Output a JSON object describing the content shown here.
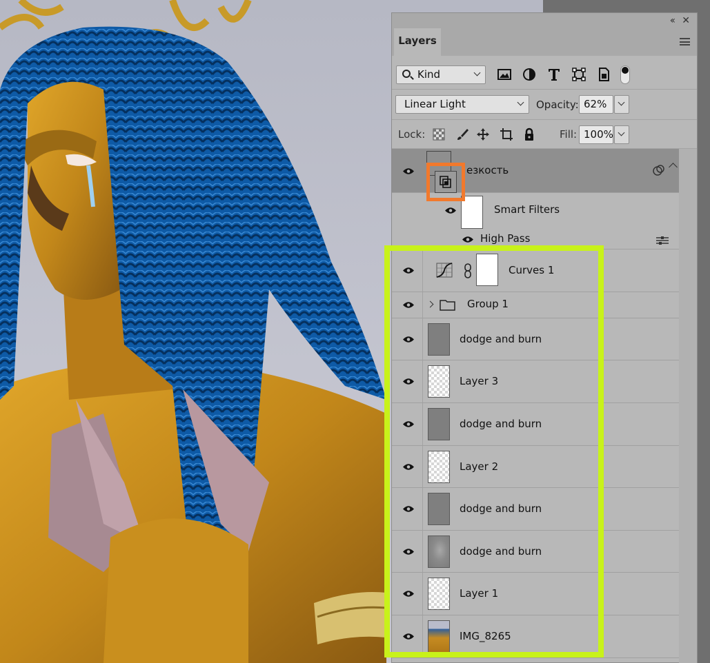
{
  "panel": {
    "tab_label": "Layers",
    "collapse_icon": "collapse-panel-icon",
    "close_icon": "close-icon",
    "menu_icon": "panel-menu-icon"
  },
  "filter": {
    "kind_label": "Kind",
    "icons": [
      "image-filter-icon",
      "adjustment-filter-icon",
      "type-filter-icon",
      "shape-filter-icon",
      "smart-object-filter-icon"
    ]
  },
  "blend": {
    "mode": "Linear Light",
    "opacity_label": "Opacity:",
    "opacity_value": "62%"
  },
  "lock": {
    "lock_label": "Lock:",
    "fill_label": "Fill:",
    "fill_value": "100%",
    "icons": [
      "lock-transparent-icon",
      "lock-paint-icon",
      "lock-position-icon",
      "lock-artboard-icon",
      "lock-all-icon"
    ]
  },
  "layers": [
    {
      "name": "езкость",
      "type": "smart-object",
      "visible": true
    },
    {
      "name": "Smart Filters",
      "type": "smart-filters",
      "visible": true
    },
    {
      "name": "High Pass",
      "type": "filter",
      "visible": true
    },
    {
      "name": "Curves 1",
      "type": "adjustment",
      "visible": true
    },
    {
      "name": "Group 1",
      "type": "group",
      "visible": true
    },
    {
      "name": "dodge and burn",
      "type": "pixel",
      "thumb": "gray",
      "visible": true
    },
    {
      "name": "Layer 3",
      "type": "pixel",
      "thumb": "transparent",
      "visible": true
    },
    {
      "name": "dodge and burn",
      "type": "pixel",
      "thumb": "gray",
      "visible": true
    },
    {
      "name": "Layer 2",
      "type": "pixel",
      "thumb": "transparent",
      "visible": true
    },
    {
      "name": "dodge and burn",
      "type": "pixel",
      "thumb": "gray",
      "visible": true
    },
    {
      "name": "dodge and burn",
      "type": "pixel",
      "thumb": "gray-texture",
      "visible": true
    },
    {
      "name": "Layer 1",
      "type": "pixel",
      "thumb": "transparent",
      "visible": true
    },
    {
      "name": "IMG_8265",
      "type": "pixel",
      "thumb": "photo",
      "visible": true
    }
  ],
  "colors": {
    "highlight": "#c8f21a",
    "smart_badge": "#f2792c",
    "hair": "#0d5aa8",
    "skin": "#c8901c"
  }
}
